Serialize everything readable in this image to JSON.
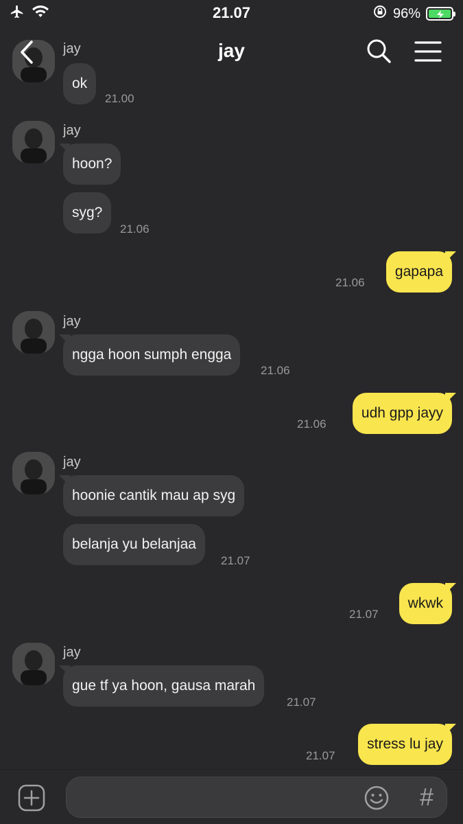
{
  "status_bar": {
    "time": "21.07",
    "battery": "96%"
  },
  "header": {
    "title": "jay"
  },
  "contact": {
    "name": "jay"
  },
  "messages": [
    {
      "sender": "jay",
      "text": "ok",
      "time": "21.00"
    },
    {
      "sender": "jay",
      "text": "hoon?",
      "time": ""
    },
    {
      "sender": "jay",
      "text": "syg?",
      "time": "21.06"
    },
    {
      "sender": "me",
      "text": "gapapa",
      "time": "21.06"
    },
    {
      "sender": "jay",
      "text": "ngga hoon sumph engga",
      "time": "21.06"
    },
    {
      "sender": "me",
      "text": "udh gpp jayy",
      "time": "21.06"
    },
    {
      "sender": "jay",
      "text": "hoonie cantik mau ap syg",
      "time": ""
    },
    {
      "sender": "jay",
      "text": "belanja yu belanjaa",
      "time": "21.07"
    },
    {
      "sender": "me",
      "text": "wkwk",
      "time": "21.07"
    },
    {
      "sender": "jay",
      "text": "gue tf ya hoon, gausa marah",
      "time": "21.07"
    },
    {
      "sender": "me",
      "text": "stress lu jay",
      "time": "21.07"
    }
  ],
  "composer": {
    "placeholder": "",
    "hash_symbol": "#"
  },
  "colors": {
    "background": "#28282a",
    "incoming_bubble": "#3c3c3e",
    "outgoing_bubble": "#f9e54e"
  },
  "icons": [
    "airplane-icon",
    "wifi-icon",
    "rotation-lock-icon",
    "battery-icon",
    "back-icon",
    "search-icon",
    "menu-icon",
    "plus-icon",
    "emoji-icon"
  ]
}
